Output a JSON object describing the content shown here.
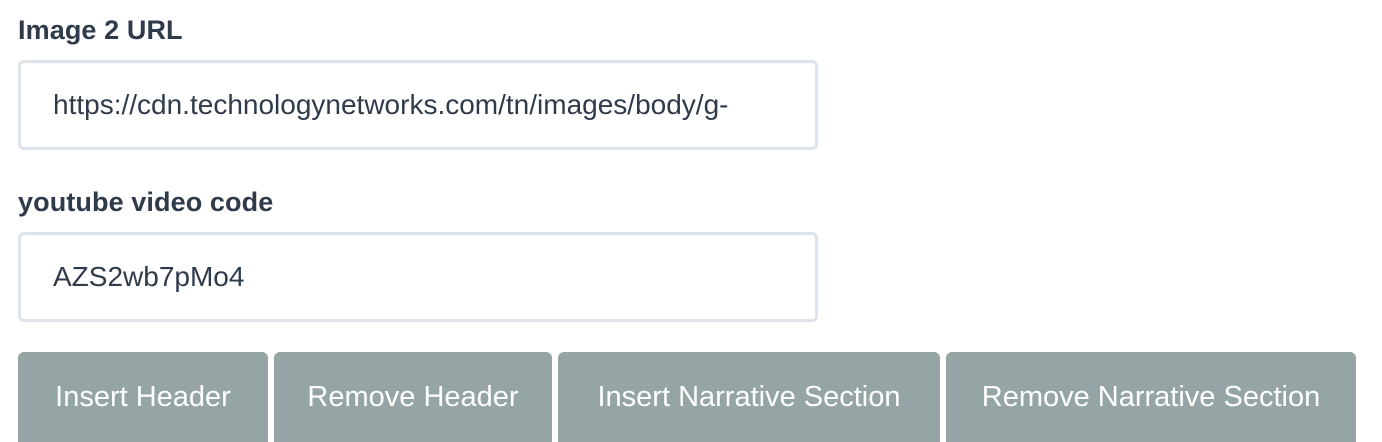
{
  "form": {
    "image2": {
      "label": "Image 2 URL",
      "value": "https://cdn.technologynetworks.com/tn/images/body/g-"
    },
    "youtube": {
      "label": "youtube video code",
      "value": "AZS2wb7pMo4"
    }
  },
  "buttons": {
    "insert_header": "Insert Header",
    "remove_header": "Remove Header",
    "insert_narrative": "Insert Narrative Section",
    "remove_narrative": "Remove Narrative Section"
  },
  "colors": {
    "button_bg": "#95a5a6",
    "label_text": "#2f3b4b",
    "field_border": "#dde3ea"
  }
}
